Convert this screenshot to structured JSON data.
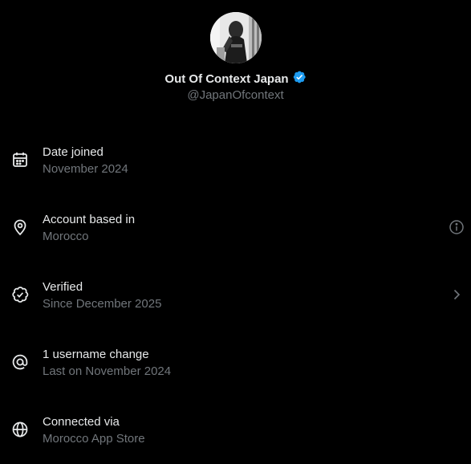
{
  "profile": {
    "display_name": "Out Of Context Japan",
    "handle": "@JapanOfcontext",
    "verified_badge_color": "#1d9bf0",
    "avatar": "avatar-image"
  },
  "rows": [
    {
      "icon": "calendar-icon",
      "title": "Date joined",
      "subtitle": "November 2024",
      "trailing": null
    },
    {
      "icon": "location-pin-icon",
      "title": "Account based in",
      "subtitle": "Morocco",
      "trailing": "info-icon"
    },
    {
      "icon": "verified-badge-icon",
      "title": "Verified",
      "subtitle": "Since December 2025",
      "trailing": "chevron-right-icon"
    },
    {
      "icon": "at-sign-icon",
      "title": "1 username change",
      "subtitle": "Last on November 2024",
      "trailing": null
    },
    {
      "icon": "globe-icon",
      "title": "Connected via",
      "subtitle": "Morocco App Store",
      "trailing": null
    }
  ],
  "colors": {
    "background": "#000000",
    "primary_text": "#e7e9ea",
    "secondary_text": "#71767b"
  }
}
